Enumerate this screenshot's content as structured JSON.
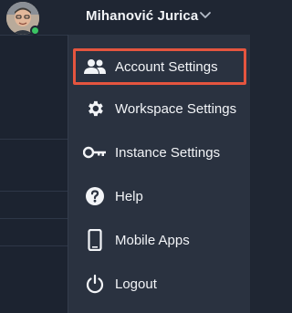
{
  "header": {
    "user_name": "Mihanović Jurica",
    "avatar_icon": "user-avatar",
    "status_color": "#3bc463",
    "chevron_icon": "chevron-down-icon"
  },
  "menu": {
    "items": [
      {
        "label": "Account Settings",
        "icon": "people-icon",
        "highlighted": true
      },
      {
        "label": "Workspace Settings",
        "icon": "gear-icon",
        "highlighted": false
      },
      {
        "label": "Instance Settings",
        "icon": "key-icon",
        "highlighted": false
      },
      {
        "label": "Help",
        "icon": "question-icon",
        "highlighted": false
      },
      {
        "label": "Mobile Apps",
        "icon": "mobile-phone-icon",
        "highlighted": false
      },
      {
        "label": "Logout",
        "icon": "power-icon",
        "highlighted": false
      }
    ]
  },
  "colors": {
    "background": "#1f2633",
    "menu_background": "#2a3240",
    "highlight_border": "#e5553f",
    "text": "#f2f4f7"
  }
}
